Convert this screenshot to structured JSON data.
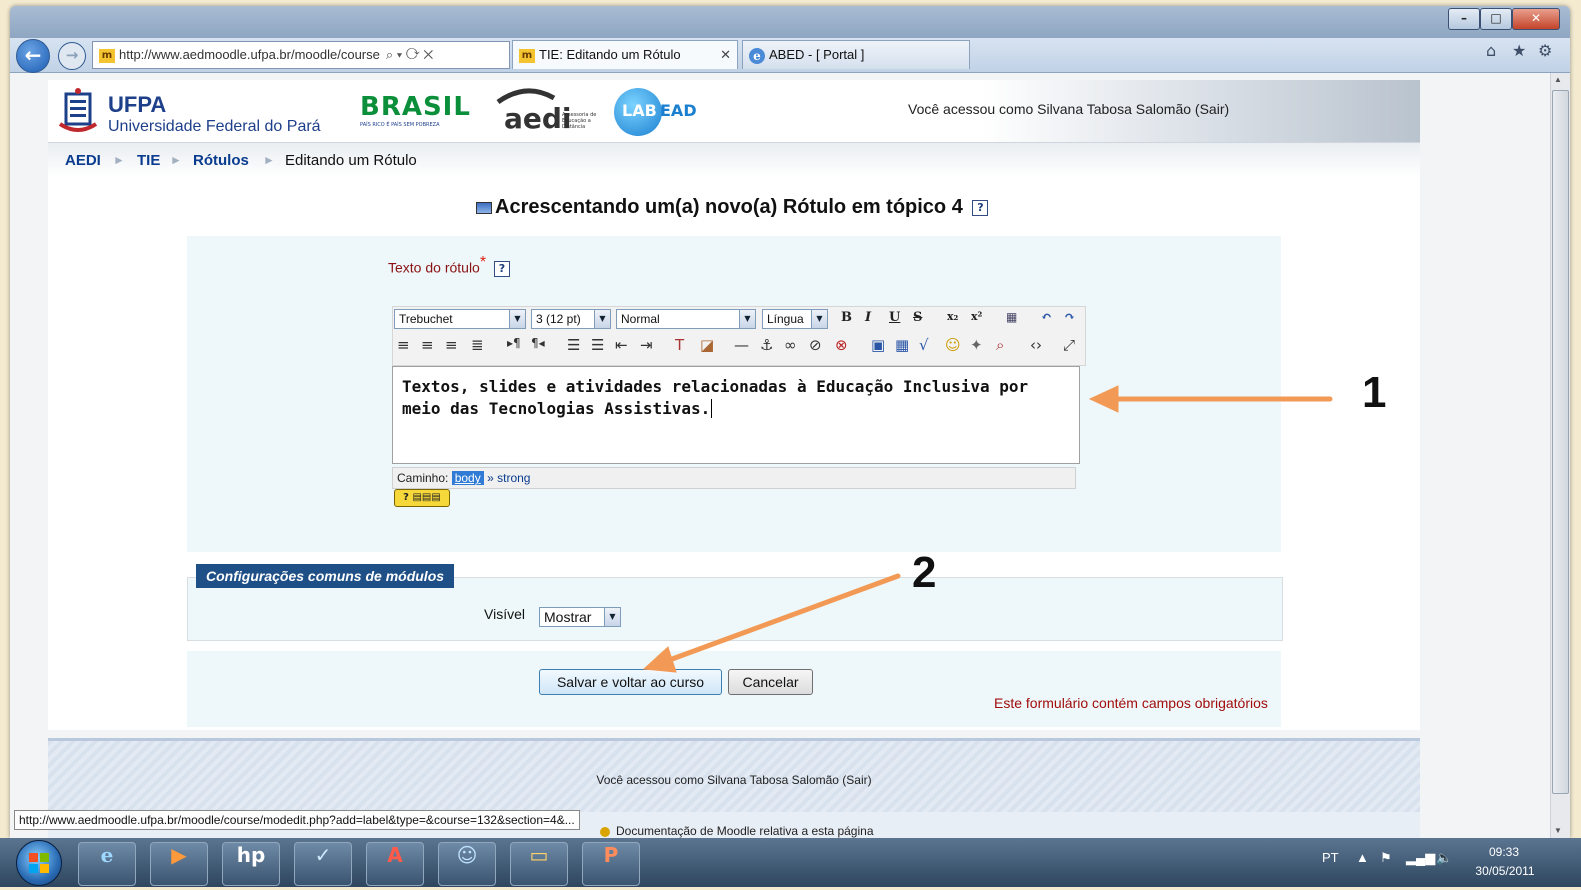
{
  "browser": {
    "address_url": "http://www.aedmoodle.ufpa.br/moodle/course",
    "address_url_bold_part": "ufpa.br",
    "tabs": [
      {
        "label": "TIE: Editando um Rótulo",
        "active": true
      },
      {
        "label": "ABED - [ Portal ]",
        "active": false
      }
    ],
    "status_url": "http://www.aedmoodle.ufpa.br/moodle/course/modedit.php?add=label&type=&course=132&section=4&..."
  },
  "header": {
    "ufpa_name": "UFPA",
    "ufpa_full": "Universidade Federal do Pará",
    "brasil_logo": "BRASIL",
    "brasil_tagline": "PAÍS RICO É PAÍS SEM POBREZA",
    "aedi_logo": "aedi",
    "aedi_tagline": "Assessoria de Educação a Distância",
    "labead_logo_lab": "LAB",
    "labead_logo_ead": "EAD",
    "login_info": "Você acessou como Silvana Tabosa Salomão (Sair)"
  },
  "breadcrumb": {
    "items": [
      "AEDI",
      "TIE",
      "Rótulos",
      "Editando um Rótulo"
    ],
    "separator": "►"
  },
  "page_heading": "Acrescentando um(a) novo(a) Rótulo em tópico 4",
  "form": {
    "field_label": "Texto do rótulo",
    "required_mark": "*",
    "help_icon": "?",
    "editor": {
      "font_family": "Trebuchet",
      "font_size": "3 (12 pt)",
      "format": "Normal",
      "language": "Língua",
      "content": "Textos, slides e atividades relacionadas à Educação Inclusiva por meio das Tecnologias Assistivas.",
      "path_label": "Caminho:",
      "path_items": [
        "body",
        "strong"
      ],
      "path_separator": "»"
    },
    "config_legend": "Configurações comuns de módulos",
    "visible_label": "Visível",
    "visible_value": "Mostrar",
    "save_label": "Salvar e voltar ao curso",
    "cancel_label": "Cancelar",
    "required_note": "Este formulário contém campos obrigatórios"
  },
  "footer": {
    "login_info": "Você acessou como Silvana Tabosa Salomão (Sair)",
    "doc_link": "Documentação de Moodle relativa a esta página"
  },
  "annotations": {
    "arrow1": "1",
    "arrow2": "2"
  },
  "taskbar": {
    "lang": "PT",
    "time": "09:33",
    "date": "30/05/2011"
  },
  "colors": {
    "link_blue": "#0a3c8f",
    "required_red": "#a10d0d",
    "legend_blue": "#1e4f86",
    "arrow_orange": "#f29a55"
  }
}
